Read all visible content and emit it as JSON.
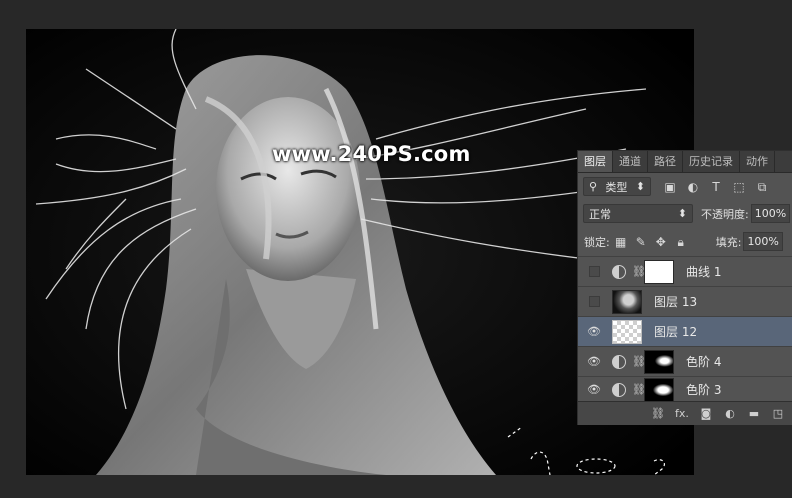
{
  "watermark": "www.240PS.com",
  "panel": {
    "tabs": [
      {
        "label": "图层",
        "active": true
      },
      {
        "label": "通道",
        "active": false
      },
      {
        "label": "路径",
        "active": false
      },
      {
        "label": "历史记录",
        "active": false
      },
      {
        "label": "动作",
        "active": false
      }
    ],
    "filter_kind": "类型",
    "filter_icons": [
      "image-filter-icon",
      "adjustment-filter-icon",
      "type-filter-icon",
      "shape-filter-icon",
      "smart-object-filter-icon"
    ],
    "blend_mode": "正常",
    "opacity_label": "不透明度:",
    "opacity_value": "100%",
    "lock_label": "锁定:",
    "lock_icons": [
      "lock-transparent-icon",
      "lock-paint-icon",
      "lock-position-icon",
      "lock-all-icon"
    ],
    "fill_label": "填充:",
    "fill_value": "100%",
    "layers": [
      {
        "name": "曲线 1",
        "visible": false,
        "type": "adjustment",
        "selected": false
      },
      {
        "name": "图层 13",
        "visible": false,
        "type": "pixel",
        "selected": false
      },
      {
        "name": "图层 12",
        "visible": true,
        "type": "pixel",
        "selected": true
      },
      {
        "name": "色阶 4",
        "visible": true,
        "type": "adjustment",
        "selected": false
      },
      {
        "name": "色阶 3",
        "visible": true,
        "type": "adjustment",
        "selected": false
      }
    ],
    "footer_icons": [
      "link-layers-icon",
      "fx-icon",
      "add-mask-icon",
      "new-adjustment-icon",
      "new-group-icon",
      "new-layer-icon"
    ],
    "fx_label": "fx."
  }
}
